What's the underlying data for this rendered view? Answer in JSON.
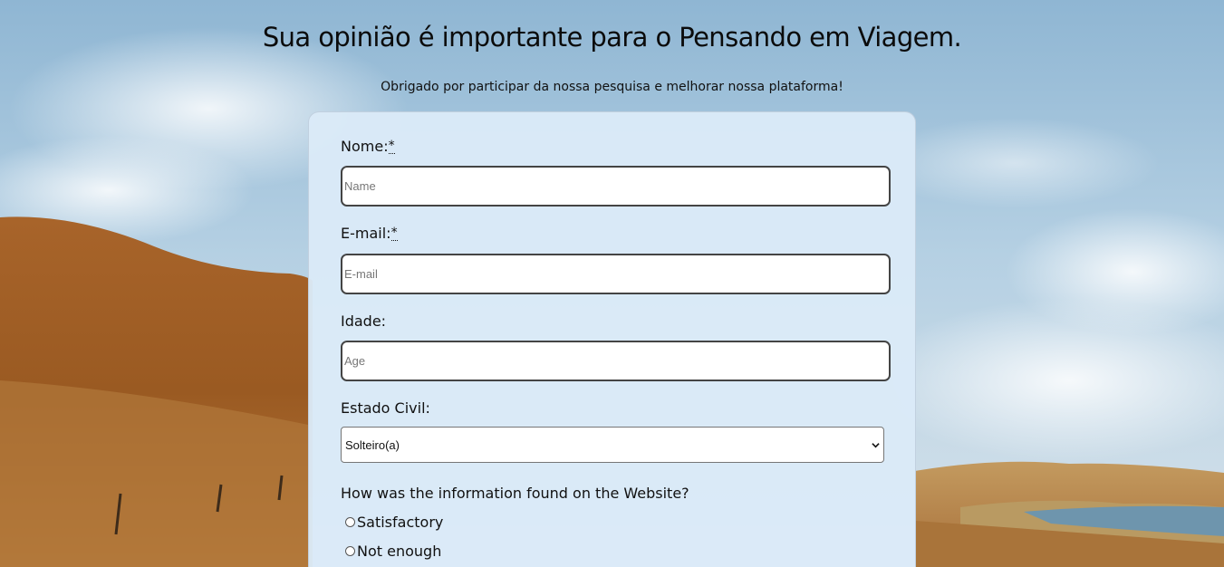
{
  "header": {
    "title": "Sua opinião é importante para o Pensando em Viagem.",
    "subtitle": "Obrigado por participar da nossa pesquisa e melhorar nossa plataforma!"
  },
  "form": {
    "name": {
      "label": "Nome:",
      "required_mark": "*",
      "placeholder": "Name"
    },
    "email": {
      "label": "E-mail:",
      "required_mark": "*",
      "placeholder": "E-mail"
    },
    "age": {
      "label": "Idade:",
      "placeholder": "Age"
    },
    "marital_status": {
      "label": "Estado Civil:",
      "selected": "Solteiro(a)"
    },
    "info_question": {
      "label": "How was the information found on the Website?",
      "options": [
        "Satisfactory",
        "Not enough"
      ]
    }
  },
  "icons": {
    "select_arrow": "chevron-down-icon",
    "radio": "radio-button-icon"
  },
  "colors": {
    "card_background": "#dbeaf8",
    "sky": "#9fc3dc",
    "hills": "#a8672a"
  }
}
